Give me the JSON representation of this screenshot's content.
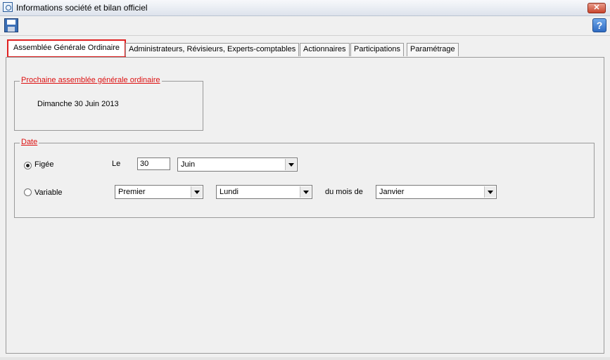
{
  "window": {
    "title": "Informations société et bilan officiel"
  },
  "icons": {
    "app": "app-icon",
    "save": "save-icon",
    "help": "help-icon",
    "close": "close-icon"
  },
  "tabs": [
    {
      "label": "Assemblée Générale Ordinaire",
      "active": true
    },
    {
      "label": "Administrateurs, Révisieurs, Experts-comptables"
    },
    {
      "label": "Actionnaires"
    },
    {
      "label": "Participations"
    },
    {
      "label": "Paramétrage"
    }
  ],
  "next_assembly": {
    "legend": "Prochaine assemblée générale ordinaire",
    "date_text": "Dimanche 30 Juin 2013"
  },
  "date": {
    "legend": "Date",
    "fixed": {
      "label": "Figée",
      "checked": true,
      "le_label": "Le",
      "day": "30",
      "month": "Juin"
    },
    "variable": {
      "label": "Variable",
      "checked": false,
      "ordinal": "Premier",
      "weekday": "Lundi",
      "of_month_label": "du mois de",
      "month": "Janvier"
    }
  },
  "colors": {
    "accent": "#e02020",
    "legend": "#dd1111"
  }
}
